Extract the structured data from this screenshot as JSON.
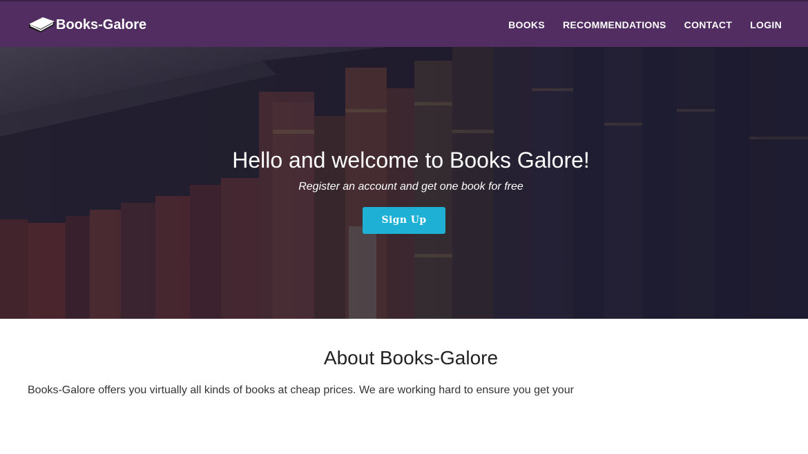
{
  "navbar": {
    "brand": "Books-Galore",
    "brand_icon": "book-icon",
    "links": [
      "BOOKS",
      "RECOMMENDATIONS",
      "CONTACT",
      "LOGIN"
    ],
    "background_color": "#522d61"
  },
  "hero": {
    "title": "Hello and welcome to Books Galore!",
    "subtitle": "Register an account and get one book for free",
    "signup_label": "Sign Up",
    "button_color": "#1fb0d6"
  },
  "about": {
    "title": "About Books-Galore",
    "text": "Books-Galore offers you virtually all kinds of books at cheap prices. We are working hard to ensure you get your"
  }
}
